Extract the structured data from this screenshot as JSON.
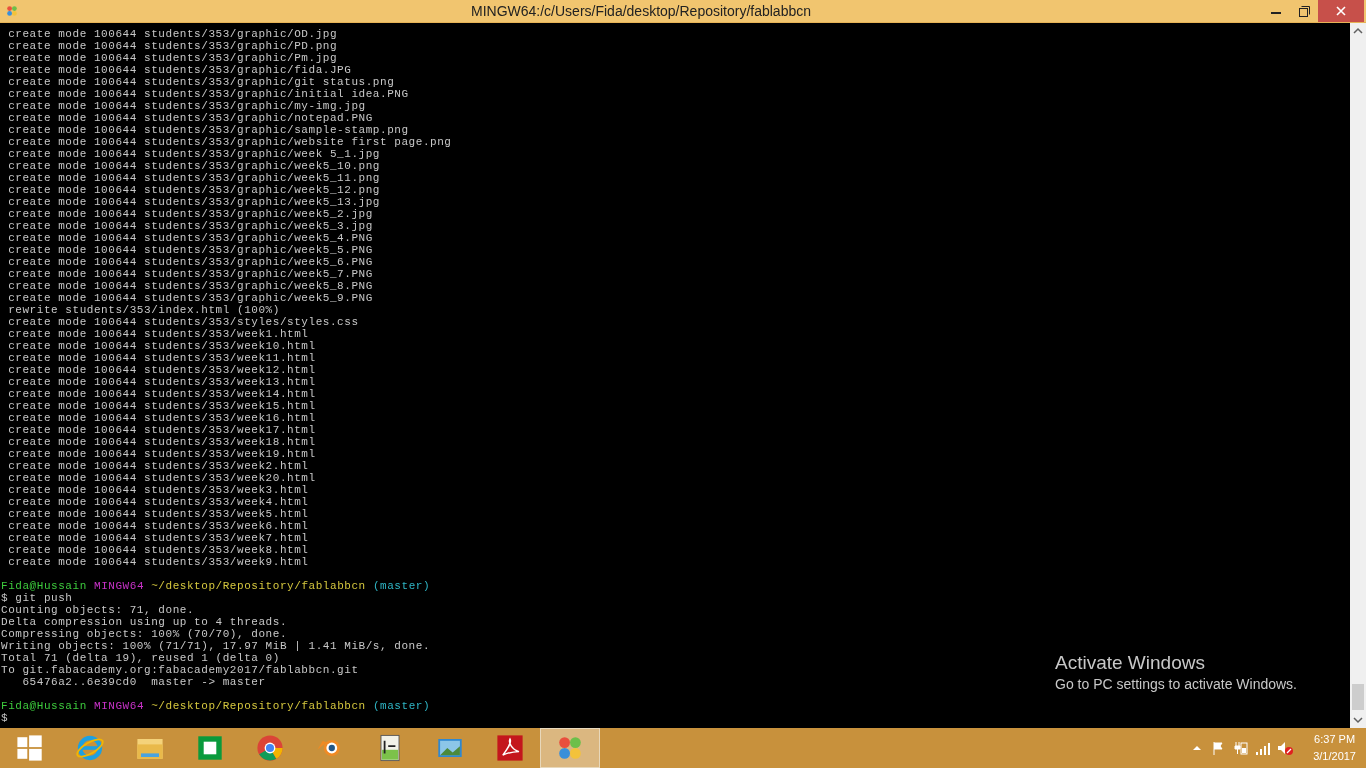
{
  "window": {
    "title": "MINGW64:/c/Users/Fida/desktop/Repository/fablabbcn"
  },
  "terminal": {
    "lines": [
      {
        "kind": "text",
        "text": " create mode 100644 students/353/graphic/OD.jpg"
      },
      {
        "kind": "text",
        "text": " create mode 100644 students/353/graphic/PD.png"
      },
      {
        "kind": "text",
        "text": " create mode 100644 students/353/graphic/Pm.jpg"
      },
      {
        "kind": "text",
        "text": " create mode 100644 students/353/graphic/fida.JPG"
      },
      {
        "kind": "text",
        "text": " create mode 100644 students/353/graphic/git status.png"
      },
      {
        "kind": "text",
        "text": " create mode 100644 students/353/graphic/initial idea.PNG"
      },
      {
        "kind": "text",
        "text": " create mode 100644 students/353/graphic/my-img.jpg"
      },
      {
        "kind": "text",
        "text": " create mode 100644 students/353/graphic/notepad.PNG"
      },
      {
        "kind": "text",
        "text": " create mode 100644 students/353/graphic/sample-stamp.png"
      },
      {
        "kind": "text",
        "text": " create mode 100644 students/353/graphic/website first page.png"
      },
      {
        "kind": "text",
        "text": " create mode 100644 students/353/graphic/week 5_1.jpg"
      },
      {
        "kind": "text",
        "text": " create mode 100644 students/353/graphic/week5_10.png"
      },
      {
        "kind": "text",
        "text": " create mode 100644 students/353/graphic/week5_11.png"
      },
      {
        "kind": "text",
        "text": " create mode 100644 students/353/graphic/week5_12.png"
      },
      {
        "kind": "text",
        "text": " create mode 100644 students/353/graphic/week5_13.jpg"
      },
      {
        "kind": "text",
        "text": " create mode 100644 students/353/graphic/week5_2.jpg"
      },
      {
        "kind": "text",
        "text": " create mode 100644 students/353/graphic/week5_3.jpg"
      },
      {
        "kind": "text",
        "text": " create mode 100644 students/353/graphic/week5_4.PNG"
      },
      {
        "kind": "text",
        "text": " create mode 100644 students/353/graphic/week5_5.PNG"
      },
      {
        "kind": "text",
        "text": " create mode 100644 students/353/graphic/week5_6.PNG"
      },
      {
        "kind": "text",
        "text": " create mode 100644 students/353/graphic/week5_7.PNG"
      },
      {
        "kind": "text",
        "text": " create mode 100644 students/353/graphic/week5_8.PNG"
      },
      {
        "kind": "text",
        "text": " create mode 100644 students/353/graphic/week5_9.PNG"
      },
      {
        "kind": "text",
        "text": " rewrite students/353/index.html (100%)"
      },
      {
        "kind": "text",
        "text": " create mode 100644 students/353/styles/styles.css"
      },
      {
        "kind": "text",
        "text": " create mode 100644 students/353/week1.html"
      },
      {
        "kind": "text",
        "text": " create mode 100644 students/353/week10.html"
      },
      {
        "kind": "text",
        "text": " create mode 100644 students/353/week11.html"
      },
      {
        "kind": "text",
        "text": " create mode 100644 students/353/week12.html"
      },
      {
        "kind": "text",
        "text": " create mode 100644 students/353/week13.html"
      },
      {
        "kind": "text",
        "text": " create mode 100644 students/353/week14.html"
      },
      {
        "kind": "text",
        "text": " create mode 100644 students/353/week15.html"
      },
      {
        "kind": "text",
        "text": " create mode 100644 students/353/week16.html"
      },
      {
        "kind": "text",
        "text": " create mode 100644 students/353/week17.html"
      },
      {
        "kind": "text",
        "text": " create mode 100644 students/353/week18.html"
      },
      {
        "kind": "text",
        "text": " create mode 100644 students/353/week19.html"
      },
      {
        "kind": "text",
        "text": " create mode 100644 students/353/week2.html"
      },
      {
        "kind": "text",
        "text": " create mode 100644 students/353/week20.html"
      },
      {
        "kind": "text",
        "text": " create mode 100644 students/353/week3.html"
      },
      {
        "kind": "text",
        "text": " create mode 100644 students/353/week4.html"
      },
      {
        "kind": "text",
        "text": " create mode 100644 students/353/week5.html"
      },
      {
        "kind": "text",
        "text": " create mode 100644 students/353/week6.html"
      },
      {
        "kind": "text",
        "text": " create mode 100644 students/353/week7.html"
      },
      {
        "kind": "text",
        "text": " create mode 100644 students/353/week8.html"
      },
      {
        "kind": "text",
        "text": " create mode 100644 students/353/week9.html"
      },
      {
        "kind": "blank"
      },
      {
        "kind": "prompt",
        "user": "Fida@Hussain",
        "system": "MINGW64",
        "path": "~/desktop/Repository/fablabbcn",
        "branch": "(master)"
      },
      {
        "kind": "text",
        "text": "$ git push"
      },
      {
        "kind": "text",
        "text": "Counting objects: 71, done."
      },
      {
        "kind": "text",
        "text": "Delta compression using up to 4 threads."
      },
      {
        "kind": "text",
        "text": "Compressing objects: 100% (70/70), done."
      },
      {
        "kind": "text",
        "text": "Writing objects: 100% (71/71), 17.97 MiB | 1.41 MiB/s, done."
      },
      {
        "kind": "text",
        "text": "Total 71 (delta 19), reused 1 (delta 0)"
      },
      {
        "kind": "text",
        "text": "To git.fabacademy.org:fabacademy2017/fablabbcn.git"
      },
      {
        "kind": "text",
        "text": "   65476a2..6e39cd0  master -> master"
      },
      {
        "kind": "blank"
      },
      {
        "kind": "prompt",
        "user": "Fida@Hussain",
        "system": "MINGW64",
        "path": "~/desktop/Repository/fablabbcn",
        "branch": "(master)"
      },
      {
        "kind": "text",
        "text": "$"
      }
    ]
  },
  "activation_notice": {
    "title": "Activate Windows",
    "message": "Go to PC settings to activate Windows."
  },
  "taskbar": {
    "apps": [
      {
        "kind": "start",
        "selected": false
      },
      {
        "kind": "browser",
        "selected": false
      },
      {
        "kind": "folder",
        "selected": false
      },
      {
        "kind": "store",
        "selected": false
      },
      {
        "kind": "chrome",
        "selected": false
      },
      {
        "kind": "blender",
        "selected": false
      },
      {
        "kind": "notepad",
        "selected": false
      },
      {
        "kind": "photos",
        "selected": false
      },
      {
        "kind": "pdf",
        "selected": false
      },
      {
        "kind": "git",
        "selected": true
      }
    ],
    "clock": {
      "time": "6:37 PM",
      "date": "3/1/2017"
    }
  }
}
